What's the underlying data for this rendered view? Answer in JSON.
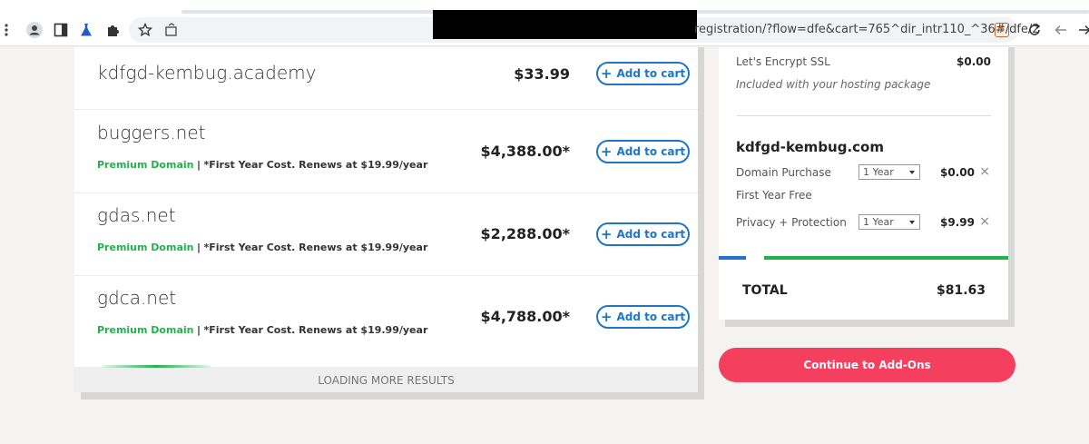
{
  "browser": {
    "url": "registration/?flow=dfe&cart=765^dir_intr110_^36#/dfe/2",
    "secure_badge": "5"
  },
  "results": [
    {
      "domain": "kdfgd-kembug.academy",
      "price": "$33.99",
      "premium": false,
      "button": "Add to cart"
    },
    {
      "domain": "buggers.net",
      "price": "$4,388.00*",
      "premium": true,
      "premium_label": "Premium Domain",
      "separator": "|",
      "note": "*First Year Cost. Renews at $19.99/year",
      "button": "Add to cart"
    },
    {
      "domain": "gdas.net",
      "price": "$2,288.00*",
      "premium": true,
      "premium_label": "Premium Domain",
      "separator": "|",
      "note": "*First Year Cost. Renews at $19.99/year",
      "button": "Add to cart"
    },
    {
      "domain": "gdca.net",
      "price": "$4,788.00*",
      "premium": true,
      "premium_label": "Premium Domain",
      "separator": "|",
      "note": "*First Year Cost. Renews at $19.99/year",
      "button": "Add to cart"
    }
  ],
  "loading": {
    "label": "LOADING MORE RESULTS"
  },
  "cart": {
    "ssl": {
      "label": "Let's Encrypt SSL",
      "amount": "$0.00",
      "note": "Included with your hosting package"
    },
    "domain_heading": "kdfgd-kembug.com",
    "domain_purchase": {
      "label": "Domain Purchase",
      "term": "1 Year",
      "amount": "$0.00",
      "note": "First Year Free",
      "remove": "×"
    },
    "privacy": {
      "label": "Privacy + Protection",
      "term": "1 Year",
      "amount": "$9.99",
      "remove": "×"
    },
    "total_label": "TOTAL",
    "total_amount": "$81.63"
  },
  "continue_button": "Continue to Add-Ons",
  "colors": {
    "accent_blue": "#1f75c9",
    "premium_green": "#22b24c",
    "cta_red": "#f43f5e"
  }
}
